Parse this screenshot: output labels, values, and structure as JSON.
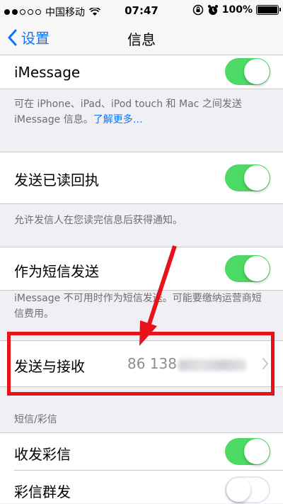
{
  "status_bar": {
    "carrier": "中国移动",
    "time": "07:47",
    "battery": "100%",
    "signal_icon": "signal-dots-icon",
    "wifi_icon": "wifi-icon",
    "lock_icon": "rotation-lock-icon",
    "alarm_icon": "alarm-clock-icon"
  },
  "navbar": {
    "back_label": "设置",
    "title": "信息"
  },
  "imessage": {
    "label": "iMessage",
    "toggle_on": true,
    "footnote": "可在 iPhone、iPad、iPod touch 和 Mac 之间发送 iMessage 信息。",
    "learn_more": "了解更多…"
  },
  "read_receipts": {
    "label": "发送已读回执",
    "toggle_on": true,
    "footnote": "允许发信人在您读完信息后获得通知。"
  },
  "send_as_sms": {
    "label": "作为短信发送",
    "toggle_on": true,
    "footnote": "iMessage 不可用时作为短信发送。可能要缴纳运营商短信费用。"
  },
  "send_receive": {
    "label": "发送与接收",
    "value": "86 138"
  },
  "sms_mms_section": {
    "header": "短信/彩信",
    "mms_label": "收发彩信",
    "mms_toggle_on": true,
    "group_label": "彩信群发",
    "group_toggle_on": false
  },
  "colors": {
    "accent": "#0a74ff",
    "toggle_on": "#4cd964",
    "annotation_red": "#e8131a"
  }
}
